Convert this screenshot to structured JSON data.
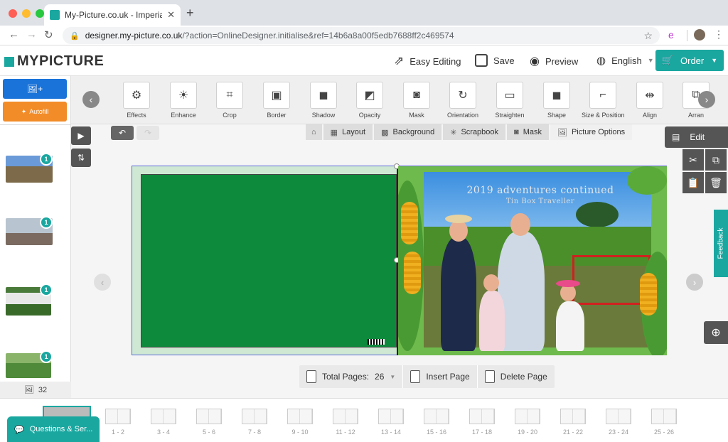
{
  "browser": {
    "tab_title": "My-Picture.co.uk - Imperial Ph",
    "tab_close": "✕",
    "new_tab": "+",
    "url_host": "designer.my-picture.co.uk",
    "url_path": "/?action=OnlineDesigner.initialise&ref=14b6a8a00f5edb7688ff2c469574",
    "ext_label": "e"
  },
  "header": {
    "logo": "MYPICTURE",
    "easy_editing": "Easy Editing",
    "save": "Save",
    "preview": "Preview",
    "language": "English",
    "order": "Order"
  },
  "toolbar": {
    "tools": [
      {
        "label": "Effects",
        "glyph": "⚙"
      },
      {
        "label": "Enhance",
        "glyph": "☀"
      },
      {
        "label": "Crop",
        "glyph": "⌗"
      },
      {
        "label": "Border",
        "glyph": "▣"
      },
      {
        "label": "Shadow",
        "glyph": "◼"
      },
      {
        "label": "Opacity",
        "glyph": "◩"
      },
      {
        "label": "Mask",
        "glyph": "◙"
      },
      {
        "label": "Orientation",
        "glyph": "↻"
      },
      {
        "label": "Straighten",
        "glyph": "▭"
      },
      {
        "label": "Shape",
        "glyph": "◼"
      },
      {
        "label": "Size & Position",
        "glyph": "⌐"
      },
      {
        "label": "Align",
        "glyph": "⇹"
      },
      {
        "label": "Arran",
        "glyph": "⧉"
      }
    ]
  },
  "sidebar": {
    "autofill_label": "Autofill",
    "photos": [
      {
        "badge": "1"
      },
      {
        "badge": "1"
      },
      {
        "badge": "1"
      },
      {
        "badge": "1"
      }
    ],
    "photo_count": "32"
  },
  "canvas": {
    "tabs": [
      "Layout",
      "Background",
      "Scrapbook",
      "Mask",
      "Picture Options"
    ],
    "photo_title": "2019 adventures continued",
    "photo_subtitle": "Tin Box Traveller",
    "total_pages_label": "Total Pages:",
    "total_pages_value": "26",
    "insert_page": "Insert Page",
    "delete_page": "Delete Page"
  },
  "rightpanel": {
    "edit_label": "Edit",
    "feedback": "Feedback"
  },
  "pages": [
    "1 - 2",
    "3 - 4",
    "5 - 6",
    "7 - 8",
    "9 - 10",
    "11 - 12",
    "13 - 14",
    "15 - 16",
    "17 - 18",
    "19 - 20",
    "21 - 22",
    "23 - 24",
    "25 - 26"
  ],
  "chat": {
    "label": "Questions & Ser..."
  },
  "colors": {
    "brand": "#1aa7a0",
    "upload": "#1a73d9",
    "autofill": "#f28c28",
    "page_green": "#0e8a3c"
  }
}
